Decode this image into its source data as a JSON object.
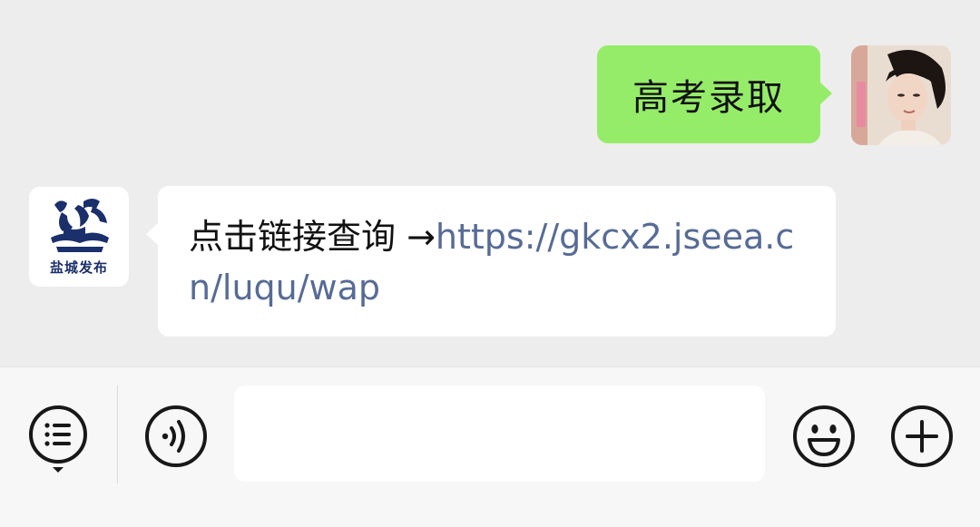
{
  "chat": {
    "outgoing": {
      "text": "高考录取",
      "avatar_icon": "user-avatar-photo",
      "bubble_color": "#95ec69"
    },
    "incoming": {
      "avatar_label": "盐城发布",
      "avatar_icon": "yancheng-fabu-logo",
      "prefix": "点击链接查询 →",
      "link": "https://gkcx2.jseea.cn/luqu/wap",
      "link_color": "#576b95"
    }
  },
  "toolbar": {
    "menu_icon": "list-menu-icon",
    "voice_icon": "voice-icon",
    "input_value": "",
    "emoji_icon": "emoji-icon",
    "plus_icon": "plus-icon"
  }
}
